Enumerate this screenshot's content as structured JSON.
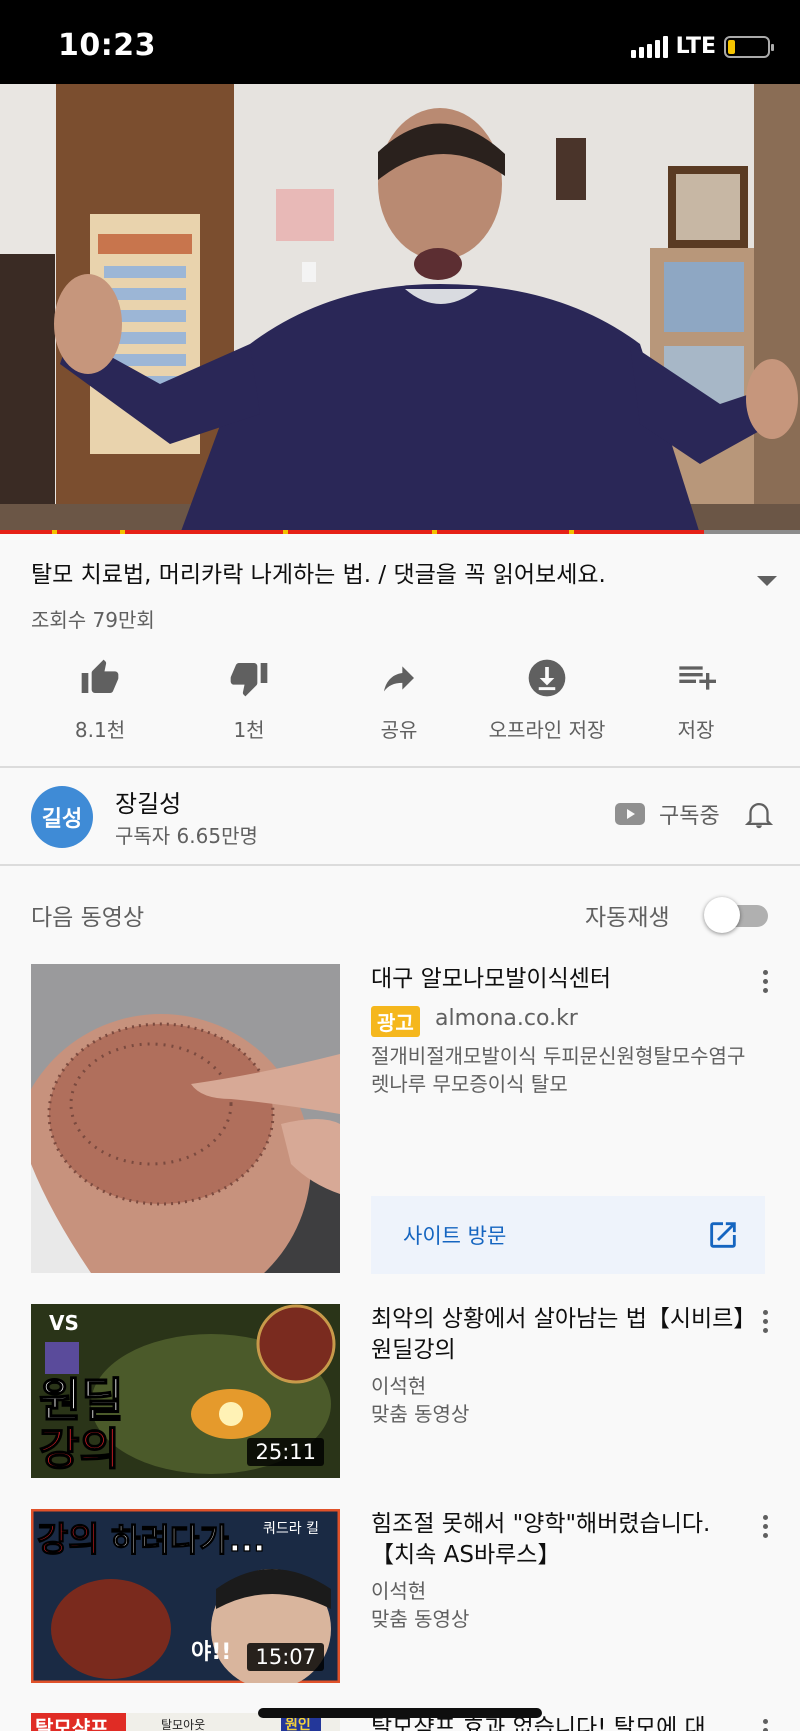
{
  "status_bar": {
    "time": "10:23",
    "network": "LTE"
  },
  "video": {
    "title": "탈모 치료법, 머리카락 나게하는 법. / 댓글을 꼭 읽어보세요.",
    "views": "조회수 79만회",
    "progress_fraction": 0.88
  },
  "actions": [
    {
      "label": "8.1천",
      "icon": "thumb-up-icon"
    },
    {
      "label": "1천",
      "icon": "thumb-down-icon"
    },
    {
      "label": "공유",
      "icon": "share-icon"
    },
    {
      "label": "오프라인 저장",
      "icon": "download-icon"
    },
    {
      "label": "저장",
      "icon": "playlist-add-icon"
    }
  ],
  "channel": {
    "avatar_text": "길성",
    "name": "장길성",
    "subscribers": "구독자 6.65만명",
    "subscribe_status": "구독중"
  },
  "up_next": {
    "header": "다음 동영상",
    "autoplay_label": "자동재생",
    "autoplay_on": false
  },
  "ad": {
    "title": "대구 알모나모발이식센터",
    "badge": "광고",
    "domain": "almona.co.kr",
    "description": "절개비절개모발이식 두피문신원형탈모수염구렛나루 무모증이식 탈모",
    "cta": "사이트 방문"
  },
  "recommendations": [
    {
      "title": "최악의 상황에서 살아남는 법【시비르】원딜강의",
      "channel": "이석현",
      "meta": "맞춤 동영상",
      "duration": "25:11",
      "thumb_text": [
        "VS",
        "원딜",
        "강의"
      ]
    },
    {
      "title": "힘조절 못해서 \"양학\"해버렸습니다.【치속 AS바루스】",
      "channel": "이석현",
      "meta": "맞춤 동영상",
      "duration": "15:07",
      "thumb_text": [
        "강의",
        "하려다가...",
        "쿼드라 킬",
        "야!!"
      ]
    },
    {
      "title": "탈모샴프 효과 없습니다! 탈모에 대",
      "thumb_text": [
        "탈모샴프",
        "탈모아웃",
        "원인"
      ]
    }
  ],
  "colors": {
    "progress": "#e62117",
    "ad_marker": "#f2c200",
    "badge": "#f5b71d",
    "link": "#1565c0",
    "avatar": "#3f8bd6"
  }
}
